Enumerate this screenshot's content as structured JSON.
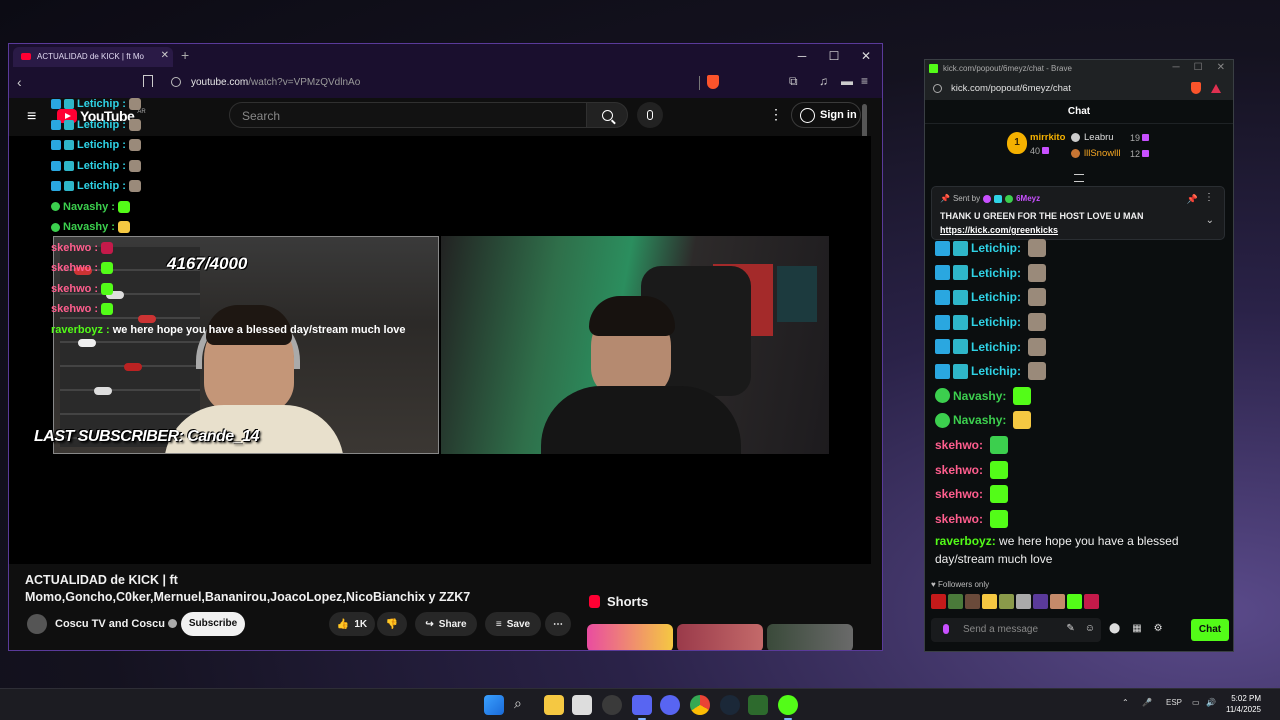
{
  "youtube_window": {
    "tab_title": "ACTUALIDAD de KICK | ft Mo",
    "url_host": "youtube.com",
    "url_path": "/watch?v=VPMzQVdlnAo",
    "search_placeholder": "Search",
    "sign_in": "Sign in",
    "logo_text": "YouTube",
    "logo_region": "AR",
    "video": {
      "sub_counter": "4167/4000",
      "last_subscriber": "LAST SUBSCRIBER: Cande_14",
      "overlay_chat": [
        {
          "user": "Letichip",
          "color": "#2fd3e6",
          "sep": " :",
          "msg": ""
        },
        {
          "user": "Letichip",
          "color": "#2fd3e6",
          "sep": " :",
          "msg": ""
        },
        {
          "user": "Letichip",
          "color": "#2fd3e6",
          "sep": " :",
          "msg": ""
        },
        {
          "user": "Letichip",
          "color": "#2fd3e6",
          "sep": " :",
          "msg": ""
        },
        {
          "user": "Letichip",
          "color": "#2fd3e6",
          "sep": " :",
          "msg": ""
        },
        {
          "user": "Navashy",
          "color": "#3ccf4e",
          "sep": " :",
          "msg": ""
        },
        {
          "user": "Navashy",
          "color": "#3ccf4e",
          "sep": " :",
          "msg": ""
        },
        {
          "user": "skehwo",
          "color": "#ff5e8e",
          "sep": " :",
          "msg": ""
        },
        {
          "user": "skehwo",
          "color": "#ff5e8e",
          "sep": " :",
          "msg": ""
        },
        {
          "user": "skehwo",
          "color": "#ff5e8e",
          "sep": " :",
          "msg": ""
        },
        {
          "user": "skehwo",
          "color": "#ff5e8e",
          "sep": " :",
          "msg": ""
        },
        {
          "user": "raverboyz",
          "color": "#53fc18",
          "sep": " :",
          "msg": "we here hope you have a blessed day/stream much love"
        }
      ]
    },
    "title_line1": "ACTUALIDAD de KICK | ft",
    "title_line2": "Momo,Goncho,C0ker,Mernuel,Bananirou,JoacoLopez,NicoBianchix y ZZK7",
    "channel_name": "Coscu TV and Coscu",
    "subscribe": "Subscribe",
    "likes": "1K",
    "share": "Share",
    "save": "Save",
    "shorts": "Shorts",
    "more": "⋯"
  },
  "kick_window": {
    "title": "kick.com/popout/6meyz/chat - Brave",
    "url": "kick.com/popout/6meyz/chat",
    "header": "Chat",
    "leaderboard": {
      "first_rank": "1",
      "first_name": "mirrkito",
      "first_count": "40",
      "others": [
        {
          "name": "Leabru",
          "count": "19",
          "color": "#dddddd"
        },
        {
          "name": "lllSnowlll",
          "count": "12",
          "color": "#f5a623"
        }
      ]
    },
    "pinned": {
      "sent_by": "Sent by",
      "author": "6Meyz",
      "message": "THANK U GREEN FOR THE HOST LOVE U MAN",
      "link": "https://kick.com/greenkicks"
    },
    "messages": [
      {
        "user": "Letichip",
        "color": "#2fd3e6",
        "type": "sub",
        "text": ""
      },
      {
        "user": "Letichip",
        "color": "#2fd3e6",
        "type": "sub",
        "text": ""
      },
      {
        "user": "Letichip",
        "color": "#2fd3e6",
        "type": "sub",
        "text": ""
      },
      {
        "user": "Letichip",
        "color": "#2fd3e6",
        "type": "sub",
        "text": ""
      },
      {
        "user": "Letichip",
        "color": "#2fd3e6",
        "type": "sub",
        "text": ""
      },
      {
        "user": "Letichip",
        "color": "#2fd3e6",
        "type": "sub",
        "text": ""
      },
      {
        "user": "Navashy",
        "color": "#3ccf4e",
        "type": "verified",
        "text": ""
      },
      {
        "user": "Navashy",
        "color": "#3ccf4e",
        "type": "verified",
        "text": ""
      },
      {
        "user": "skehwo",
        "color": "#ff5e8e",
        "type": "plain",
        "text": ""
      },
      {
        "user": "skehwo",
        "color": "#ff5e8e",
        "type": "plain",
        "text": ""
      },
      {
        "user": "skehwo",
        "color": "#ff5e8e",
        "type": "plain",
        "text": ""
      },
      {
        "user": "skehwo",
        "color": "#ff5e8e",
        "type": "plain",
        "text": ""
      }
    ],
    "last_message_user": "raverboyz",
    "last_message_text": " we here hope you have a blessed day/stream much love",
    "followers_only": "Followers only",
    "input_placeholder": "Send a message",
    "send": "Chat"
  },
  "taskbar": {
    "lang": "ESP",
    "time": "5:02 PM",
    "date": "11/4/2025"
  },
  "colors": {
    "kick_green": "#53fc18",
    "youtube_red": "#ff0033",
    "window_border": "#5a3a9a"
  }
}
